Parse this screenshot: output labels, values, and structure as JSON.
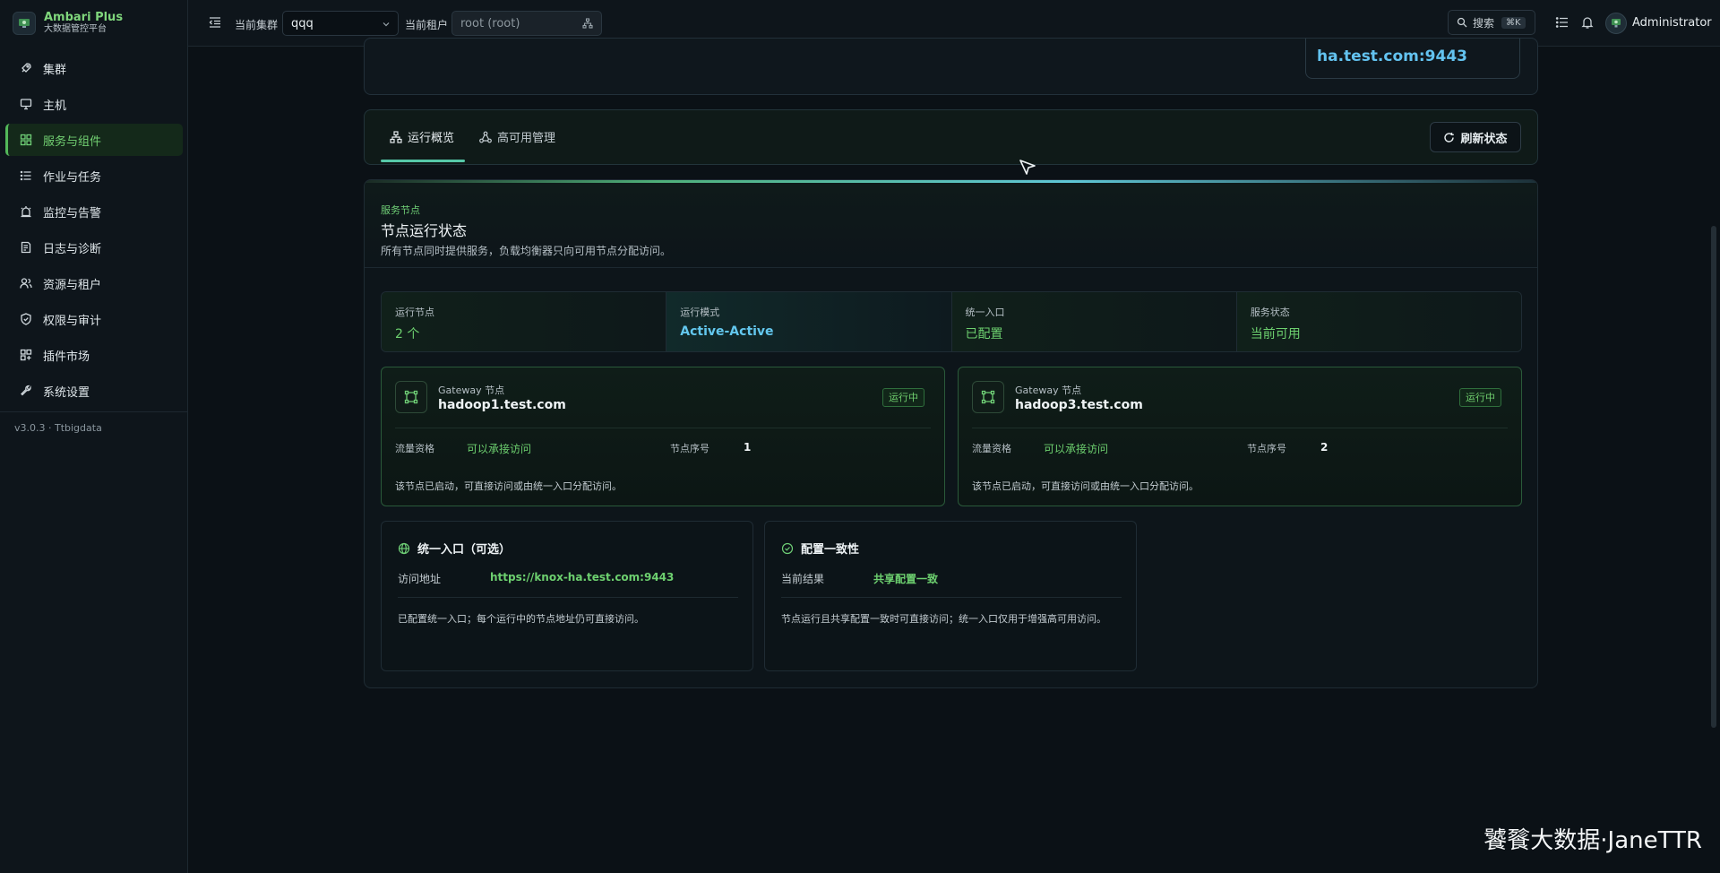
{
  "brand": {
    "name": "Ambari Plus",
    "subtitle": "大数据管控平台"
  },
  "sidebar": {
    "items": [
      {
        "label": "集群",
        "icon": "rocket-icon",
        "active": false
      },
      {
        "label": "主机",
        "icon": "monitor-icon",
        "active": false
      },
      {
        "label": "服务与组件",
        "icon": "grid-icon",
        "active": true
      },
      {
        "label": "作业与任务",
        "icon": "list-icon",
        "active": false
      },
      {
        "label": "监控与告警",
        "icon": "alarm-icon",
        "active": false
      },
      {
        "label": "日志与诊断",
        "icon": "log-icon",
        "active": false
      },
      {
        "label": "资源与租户",
        "icon": "users-icon",
        "active": false
      },
      {
        "label": "权限与审计",
        "icon": "shield-icon",
        "active": false
      },
      {
        "label": "插件市场",
        "icon": "plugin-icon",
        "active": false
      },
      {
        "label": "系统设置",
        "icon": "wrench-icon",
        "active": false
      }
    ],
    "version": "v3.0.3 · Ttbigdata"
  },
  "topbar": {
    "cluster_label": "当前集群",
    "cluster_value": "qqq",
    "tenant_label": "当前租户",
    "tenant_placeholder": "root (root)",
    "search_label": "搜索",
    "search_shortcut": "⌘K",
    "user": "Administrator"
  },
  "top_card": {
    "ha_address": "ha.test.com:9443"
  },
  "tabs": [
    {
      "label": "运行概览",
      "icon": "topology-icon",
      "active": true
    },
    {
      "label": "高可用管理",
      "icon": "cluster-icon",
      "active": false
    }
  ],
  "refresh_label": "刷新状态",
  "section": {
    "eyebrow": "服务节点",
    "title": "节点运行状态",
    "description": "所有节点同时提供服务，负载均衡器只向可用节点分配访问。"
  },
  "stats": [
    {
      "label": "运行节点",
      "value": "2 个"
    },
    {
      "label": "运行模式",
      "value": "Active-Active"
    },
    {
      "label": "统一入口",
      "value": "已配置"
    },
    {
      "label": "服务状态",
      "value": "当前可用"
    }
  ],
  "nodes": [
    {
      "type": "Gateway 节点",
      "host": "hadoop1.test.com",
      "status": "运行中",
      "traffic_label": "流量资格",
      "traffic_value": "可以承接访问",
      "seq_label": "节点序号",
      "seq_value": "1",
      "note": "该节点已启动，可直接访问或由统一入口分配访问。"
    },
    {
      "type": "Gateway 节点",
      "host": "hadoop3.test.com",
      "status": "运行中",
      "traffic_label": "流量资格",
      "traffic_value": "可以承接访问",
      "seq_label": "节点序号",
      "seq_value": "2",
      "note": "该节点已启动，可直接访问或由统一入口分配访问。"
    }
  ],
  "entry_card": {
    "title": "统一入口（可选）",
    "label": "访问地址",
    "value": "https://knox-ha.test.com:9443",
    "note": "已配置统一入口；每个运行中的节点地址仍可直接访问。"
  },
  "consistency_card": {
    "title": "配置一致性",
    "label": "当前结果",
    "value": "共享配置一致",
    "note": "节点运行且共享配置一致时可直接访问；统一入口仅用于增强高可用访问。"
  },
  "watermark": "饕餮大数据·JaneTTR",
  "colors": {
    "accent_green": "#6dd06f",
    "accent_blue": "#63c7ee",
    "background": "#0b1116"
  }
}
